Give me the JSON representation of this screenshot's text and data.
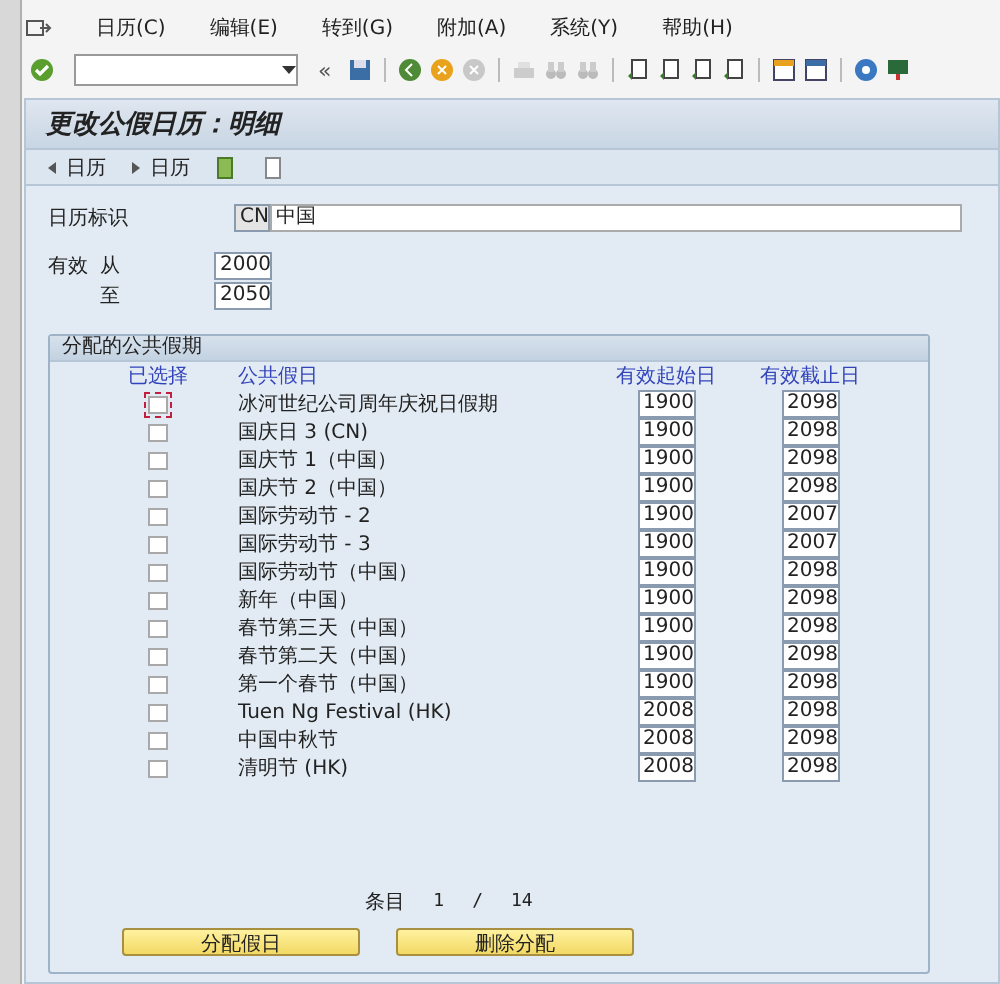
{
  "menu": [
    "日历(C)",
    "编辑(E)",
    "转到(G)",
    "附加(A)",
    "系统(Y)",
    "帮助(H)"
  ],
  "toolbar": {
    "collapse": "«"
  },
  "title": "更改公假日历：明细",
  "app_toolbar": [
    {
      "label": "日历",
      "kind": "prev"
    },
    {
      "label": "日历",
      "kind": "next"
    }
  ],
  "calendar_id": {
    "label": "日历标识",
    "code": "CN",
    "name": "中国"
  },
  "validity": {
    "label": "有效",
    "from_label": "从",
    "from": "2000",
    "to_label": "至",
    "to": "2050"
  },
  "group": {
    "title": "分配的公共假期",
    "columns": [
      "已选择",
      "公共假日",
      "有效起始日",
      "有效截止日"
    ],
    "rows": [
      {
        "checked": false,
        "focused": true,
        "name": "冰河世纪公司周年庆祝日假期",
        "start": "1900",
        "end": "2098"
      },
      {
        "checked": false,
        "focused": false,
        "name": "国庆日 3 (CN)",
        "start": "1900",
        "end": "2098"
      },
      {
        "checked": false,
        "focused": false,
        "name": "国庆节 1（中国）",
        "start": "1900",
        "end": "2098"
      },
      {
        "checked": false,
        "focused": false,
        "name": "国庆节 2（中国）",
        "start": "1900",
        "end": "2098"
      },
      {
        "checked": false,
        "focused": false,
        "name": "国际劳动节 - 2",
        "start": "1900",
        "end": "2007"
      },
      {
        "checked": false,
        "focused": false,
        "name": "国际劳动节 - 3",
        "start": "1900",
        "end": "2007"
      },
      {
        "checked": false,
        "focused": false,
        "name": "国际劳动节（中国）",
        "start": "1900",
        "end": "2098"
      },
      {
        "checked": false,
        "focused": false,
        "name": "新年（中国）",
        "start": "1900",
        "end": "2098"
      },
      {
        "checked": false,
        "focused": false,
        "name": "春节第三天（中国）",
        "start": "1900",
        "end": "2098"
      },
      {
        "checked": false,
        "focused": false,
        "name": "春节第二天（中国）",
        "start": "1900",
        "end": "2098"
      },
      {
        "checked": false,
        "focused": false,
        "name": "第一个春节（中国）",
        "start": "1900",
        "end": "2098"
      },
      {
        "checked": false,
        "focused": false,
        "name": "Tuen Ng Festival (HK)",
        "start": "2008",
        "end": "2098"
      },
      {
        "checked": false,
        "focused": false,
        "name": "中国中秋节",
        "start": "2008",
        "end": "2098"
      },
      {
        "checked": false,
        "focused": false,
        "name": "清明节 (HK)",
        "start": "2008",
        "end": "2098"
      }
    ],
    "entry": {
      "label": "条目",
      "current": "1",
      "separator": "/",
      "total": "14"
    },
    "buttons": [
      "分配假日",
      "删除分配"
    ]
  }
}
